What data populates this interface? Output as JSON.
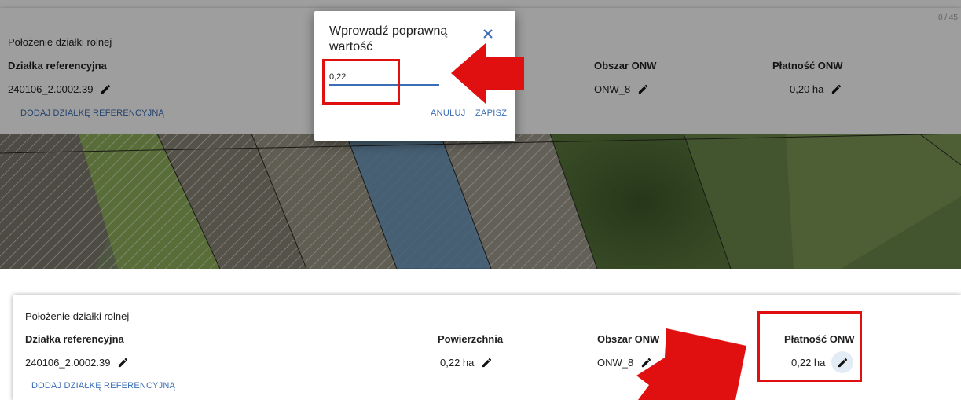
{
  "top": {
    "counter": "0 / 45",
    "section_title": "Położenie działki rolnej",
    "columns": {
      "ref": "Działka referencyjna",
      "area_zone": "Obszar ONW",
      "payment": "Płatność ONW"
    },
    "values": {
      "ref": "240106_2.0002.39",
      "area_zone": "ONW_8",
      "payment": "0,20 ha"
    },
    "add_ref_link": "DODAJ DZIAŁKĘ REFERENCYJNĄ"
  },
  "dialog": {
    "title": "Wprowadź poprawną wartość",
    "input_value": "0,22",
    "cancel_label": "ANULUJ",
    "save_label": "ZAPISZ"
  },
  "bottom": {
    "section_title": "Położenie działki rolnej",
    "columns": {
      "ref": "Działka referencyjna",
      "surface": "Powierzchnia",
      "area_zone": "Obszar ONW",
      "payment": "Płatność ONW"
    },
    "values": {
      "ref": "240106_2.0002.39",
      "surface": "0,22 ha",
      "area_zone": "ONW_8",
      "payment": "0,22 ha"
    },
    "add_ref_link": "DODAJ DZIAŁKĘ REFERENCYJNĄ"
  },
  "colors": {
    "link": "#3a6db5",
    "annotation_red": "#e01010",
    "highlight_btn_bg": "#e3ebf5"
  },
  "icons": [
    "pencil-icon",
    "close-icon",
    "arrow-annotation"
  ]
}
